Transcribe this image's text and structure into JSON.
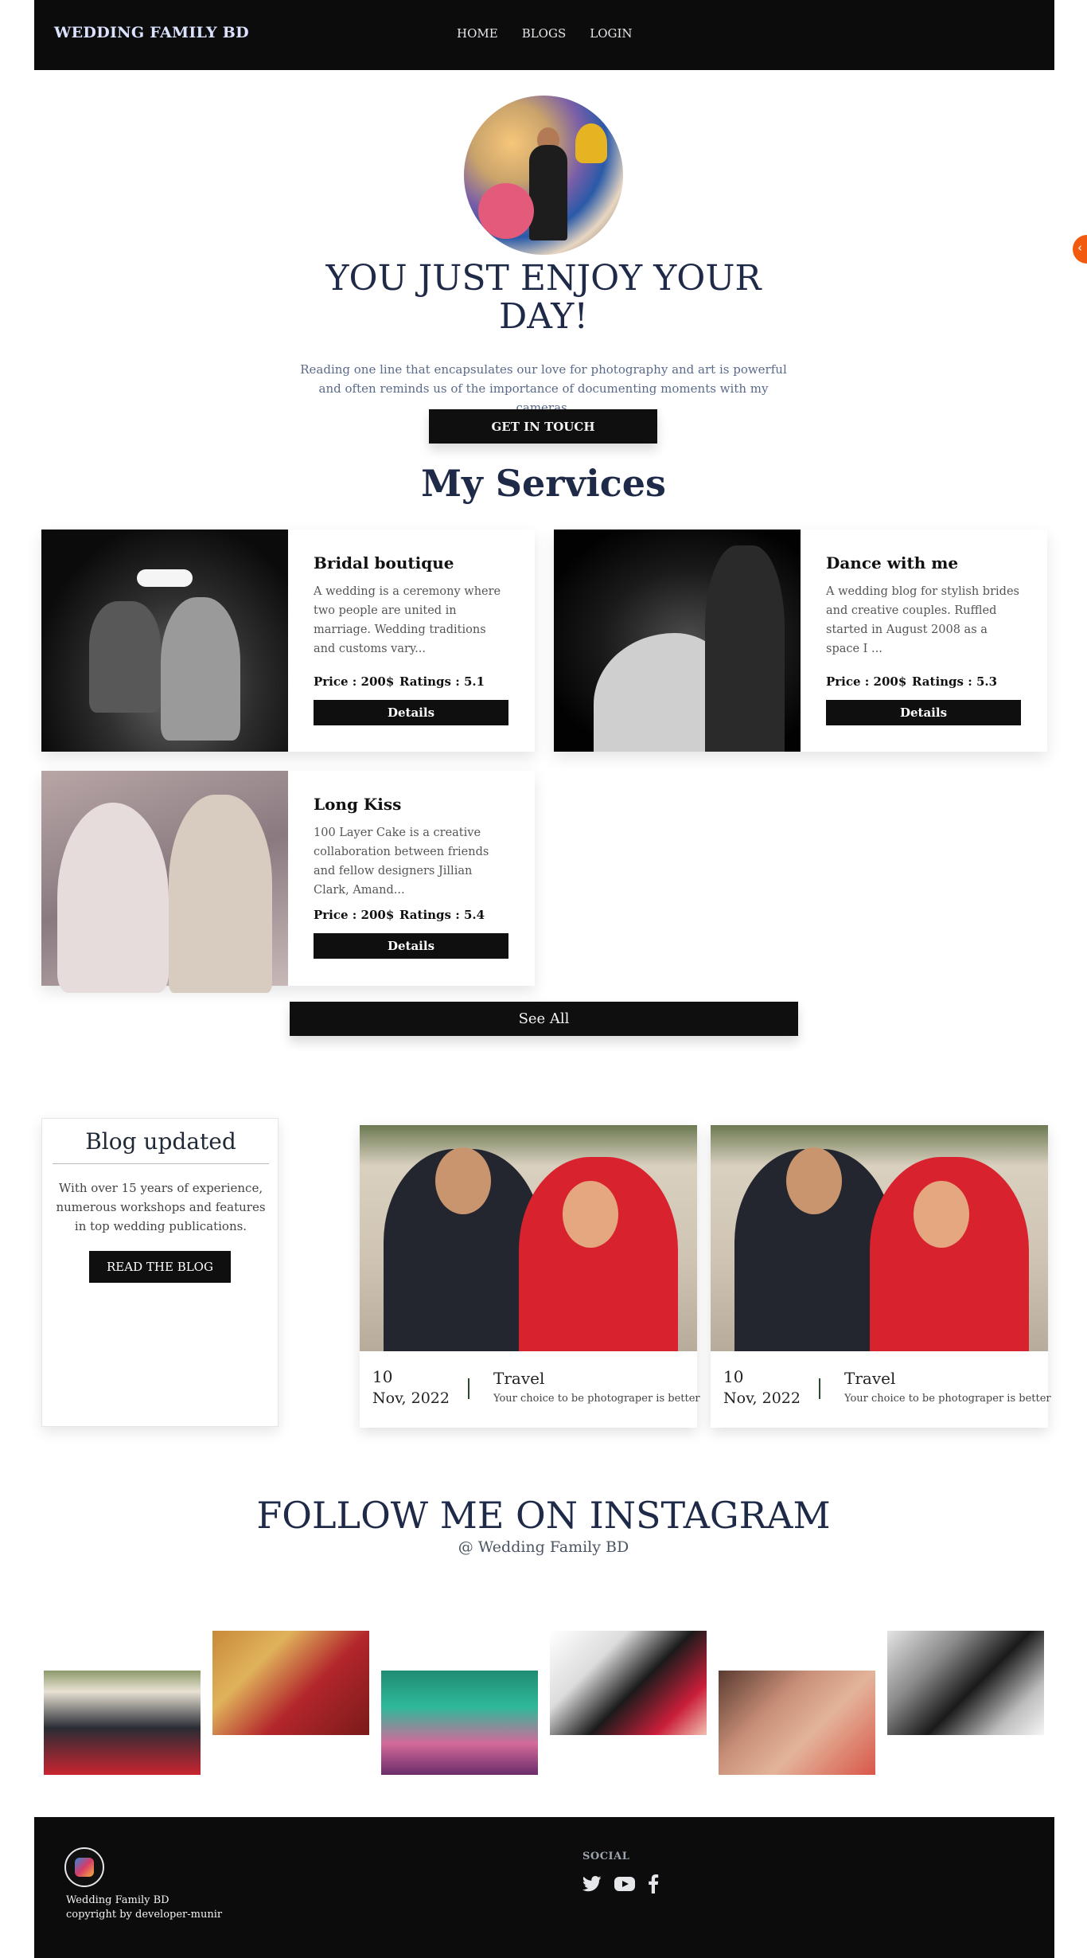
{
  "navbar": {
    "brand": "WEDDING FAMILY BD",
    "links": [
      "HOME",
      "BLOGS",
      "LOGIN"
    ]
  },
  "side_tab": {
    "icon": "chevron-left-icon",
    "glyph": "‹"
  },
  "hero": {
    "title": "YOU JUST ENJOY YOUR DAY!",
    "text": "Reading one line that encapsulates our love for photography and art is powerful and often reminds us of the importance of documenting moments with my cameras.",
    "button": "GET IN TOUCH"
  },
  "services": {
    "title": "My Services",
    "items": [
      {
        "name": "Bridal boutique",
        "description": "A wedding is a ceremony where two people are united in marriage. Wedding traditions and customs vary...",
        "price": "Price : 200$",
        "ratings": "Ratings : 5.1",
        "button": "Details"
      },
      {
        "name": "Dance with me",
        "description": "A wedding blog for stylish brides and creative couples. Ruffled started in August 2008 as a space I ...",
        "price": "Price : 200$",
        "ratings": "Ratings : 5.3",
        "button": "Details"
      },
      {
        "name": "Long Kiss",
        "description": "100 Layer Cake is a creative collaboration between friends and fellow designers Jillian Clark, Amand...",
        "price": "Price : 200$",
        "ratings": "Ratings : 5.4",
        "button": "Details"
      }
    ],
    "see_all": "See All"
  },
  "blog": {
    "title": "Blog updated",
    "text": "With over 15 years of experience, numerous workshops and features in top wedding publications.",
    "button": "READ THE BLOG",
    "posts": [
      {
        "day": "10",
        "month": "Nov, 2022",
        "category": "Travel",
        "subtitle": "Your choice to be photograper is better"
      },
      {
        "day": "10",
        "month": "Nov, 2022",
        "category": "Travel",
        "subtitle": "Your choice to be photograper is better"
      }
    ]
  },
  "instagram": {
    "title": "FOLLOW ME ON INSTAGRAM",
    "handle": "@ Wedding Family BD"
  },
  "footer": {
    "name": "Wedding Family BD",
    "copyright": "copyright by developer-munir",
    "social_label": "SOCIAL",
    "social_icons": [
      "twitter-icon",
      "youtube-icon",
      "facebook-icon"
    ]
  },
  "colors": {
    "nav_bg": "#0c0c0c",
    "button_bg": "#0f0f10",
    "heading": "#1e2a47",
    "accent_tab": "#f15a0f"
  }
}
